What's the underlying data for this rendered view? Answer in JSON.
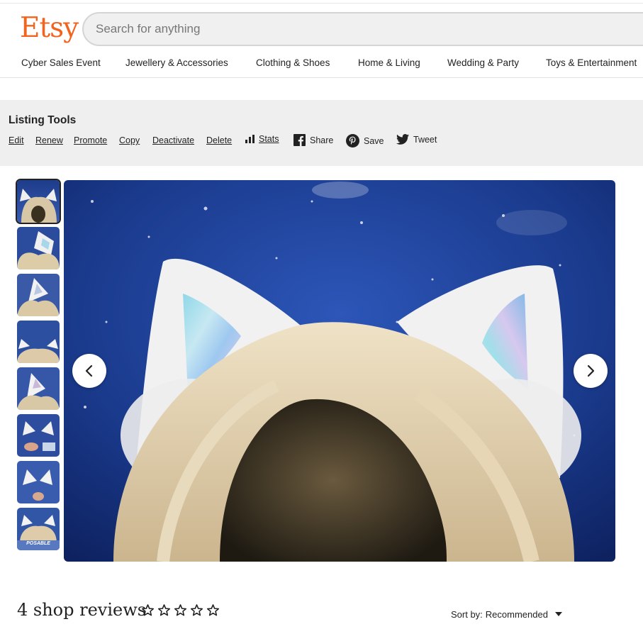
{
  "header": {
    "logo": "Etsy",
    "search_placeholder": "Search for anything"
  },
  "nav": {
    "items": [
      "Cyber Sales Event",
      "Jewellery & Accessories",
      "Clothing & Shoes",
      "Home & Living",
      "Wedding & Party",
      "Toys & Entertainment"
    ]
  },
  "listing_tools": {
    "title": "Listing Tools",
    "links": [
      "Edit",
      "Renew",
      "Promote",
      "Copy",
      "Deactivate",
      "Delete"
    ],
    "stats_label": "Stats",
    "share_label": "Share",
    "save_label": "Save",
    "tweet_label": "Tweet"
  },
  "gallery": {
    "thumbnail_count": 8,
    "active_index": 0,
    "last_thumb_caption": "POSABLE"
  },
  "reviews": {
    "title": "4 shop reviews",
    "rating_stars": 0,
    "sort_label": "Sort by:",
    "sort_value": "Recommended"
  },
  "colors": {
    "brand": "#f1641e",
    "tools_bg": "#efefef"
  }
}
